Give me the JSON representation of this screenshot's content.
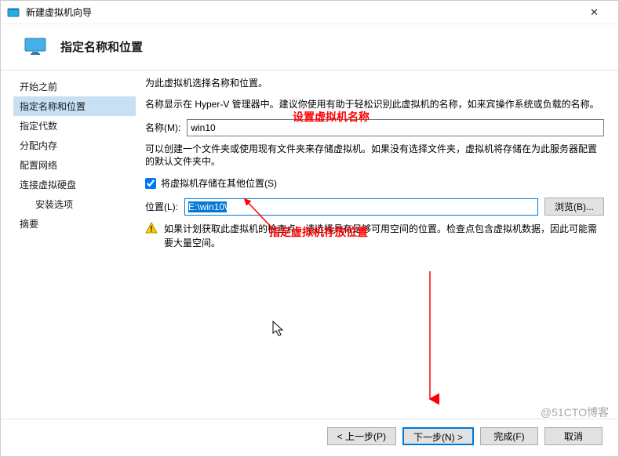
{
  "window": {
    "title": "新建虚拟机向导",
    "close_symbol": "✕"
  },
  "header": {
    "heading": "指定名称和位置"
  },
  "sidebar": {
    "steps": [
      "开始之前",
      "指定名称和位置",
      "指定代数",
      "分配内存",
      "配置网络",
      "连接虚拟硬盘",
      "安装选项",
      "摘要"
    ]
  },
  "content": {
    "intro": "为此虚拟机选择名称和位置。",
    "desc": "名称显示在 Hyper-V 管理器中。建议你使用有助于轻松识别此虚拟机的名称，如来宾操作系统或负载的名称。",
    "name_label": "名称(M):",
    "name_value": "win10",
    "folder_hint": "可以创建一个文件夹或使用现有文件夹来存储虚拟机。如果没有选择文件夹，虚拟机将存储在为此服务器配置的默认文件夹中。",
    "checkbox_label": "将虚拟机存储在其他位置(S)",
    "checkbox_checked": true,
    "location_label": "位置(L):",
    "location_value": "E:\\win10\\",
    "browse_label": "浏览(B)...",
    "warning_text": "如果计划获取此虚拟机的检查点，请选择具有足够可用空间的位置。检查点包含虚拟机数据，因此可能需要大量空间。"
  },
  "annotations": {
    "name_hint": "设置虚拟机名称",
    "location_hint": "指定虚拟机存放位置"
  },
  "footer": {
    "prev": "< 上一步(P)",
    "next": "下一步(N) >",
    "finish": "完成(F)",
    "cancel": "取消"
  },
  "watermark": "@51CTO博客"
}
